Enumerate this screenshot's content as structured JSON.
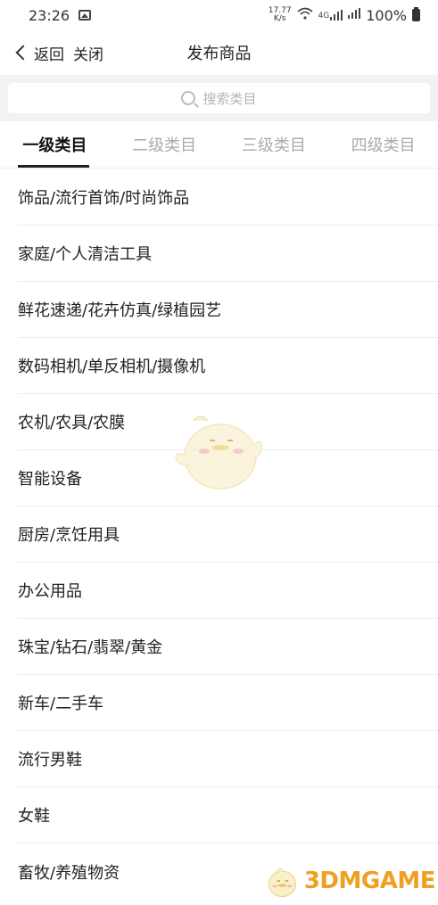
{
  "status": {
    "time": "23:26",
    "speed_top": "17.77",
    "speed_unit": "K/s",
    "network": "4G",
    "battery": "100%"
  },
  "nav": {
    "back_label": "返回",
    "close_label": "关闭",
    "title": "发布商品"
  },
  "search": {
    "placeholder": "搜索类目"
  },
  "tabs": [
    {
      "label": "一级类目",
      "active": true
    },
    {
      "label": "二级类目",
      "active": false
    },
    {
      "label": "三级类目",
      "active": false
    },
    {
      "label": "四级类目",
      "active": false
    }
  ],
  "categories": [
    "饰品/流行首饰/时尚饰品",
    "家庭/个人清洁工具",
    "鲜花速递/花卉仿真/绿植园艺",
    "数码相机/单反相机/摄像机",
    "农机/农具/农膜",
    "智能设备",
    "厨房/烹饪用具",
    "办公用品",
    "珠宝/钻石/翡翠/黄金",
    "新车/二手车",
    "流行男鞋",
    "女鞋",
    "畜牧/养殖物资"
  ],
  "watermark": {
    "text": "3DMGAME"
  }
}
